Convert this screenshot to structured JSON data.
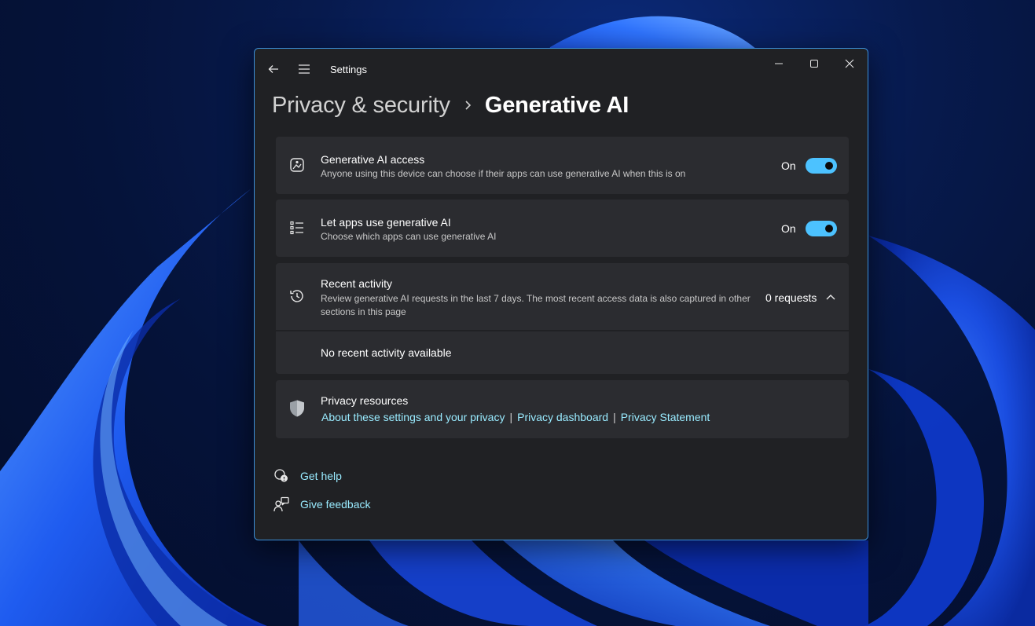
{
  "window": {
    "app_title": "Settings"
  },
  "breadcrumb": {
    "parent": "Privacy & security",
    "current": "Generative AI"
  },
  "settings": [
    {
      "title": "Generative AI access",
      "description": "Anyone using this device can choose if their apps can use generative AI when this is on",
      "state": "On",
      "icon": "ai-image-icon"
    },
    {
      "title": "Let apps use generative AI",
      "description": "Choose which apps can use generative AI",
      "state": "On",
      "icon": "list-icon"
    }
  ],
  "recent_activity": {
    "title": "Recent activity",
    "description_line1": "Review generative AI requests in the last 7 days. The most recent access data is also captured in other",
    "description_line2": "sections in this page",
    "count": "0 requests",
    "empty_message": "No recent activity available",
    "icon": "history-icon"
  },
  "privacy_resources": {
    "title": "Privacy resources",
    "links": [
      "About these settings and your privacy",
      "Privacy dashboard",
      "Privacy Statement"
    ],
    "separator": "|",
    "icon": "shield-icon"
  },
  "footer": {
    "get_help": "Get help",
    "give_feedback": "Give feedback"
  },
  "colors": {
    "accent": "#4cc2ff",
    "link": "#99ebff",
    "window_bg": "#202124",
    "card_bg": "#2b2c30"
  }
}
